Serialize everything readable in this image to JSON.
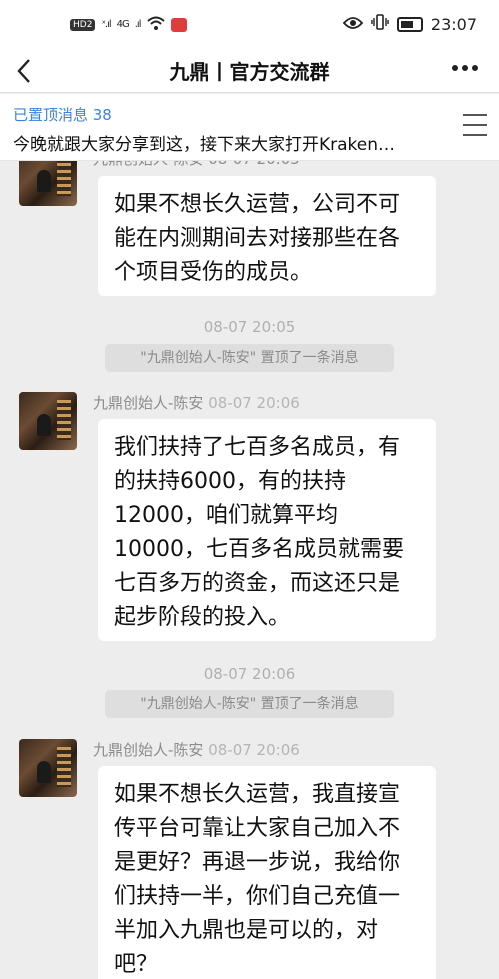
{
  "status_bar": {
    "hd_badge": "HD2",
    "signal_1": "ˣ.ıl",
    "network_label": "4G",
    "signal_2": ".ıl",
    "time": "23:07"
  },
  "header": {
    "title": "九鼎丨官方交流群",
    "back_icon": "chevron-left-icon",
    "more_icon": "ellipsis-icon"
  },
  "pinned": {
    "count_label": "已置顶消息 38",
    "preview": "今晚就跟大家分享到这，接下来大家打开Kraken…"
  },
  "messages": [
    {
      "sender": "九鼎创始人-陈安",
      "time": "08-07 20:05",
      "text": "如果不想长久运营，公司不可能在内测期间去对接那些在各个项目受伤的成员。"
    },
    {
      "sender": "九鼎创始人-陈安",
      "time": "08-07 20:06",
      "text": "我们扶持了七百多名成员，有的扶持6000，有的扶持12000，咱们就算平均10000，七百多名成员就需要七百多万的资金，而这还只是起步阶段的投入。"
    },
    {
      "sender": "九鼎创始人-陈安",
      "time": "08-07 20:06",
      "text": "如果不想长久运营，我直接宣传平台可靠让大家自己加入不是更好？再退一步说，我给你们扶持一半，你们自己充值一半加入九鼎也是可以的，对吧？"
    }
  ],
  "timestamps": [
    "08-07 20:05",
    "08-07 20:06"
  ],
  "system_notices": [
    "\"九鼎创始人-陈安\" 置顶了一条消息",
    "\"九鼎创始人-陈安\" 置顶了一条消息"
  ],
  "colors": {
    "accent_blue": "#3e82d8",
    "chat_background": "#ededed"
  }
}
